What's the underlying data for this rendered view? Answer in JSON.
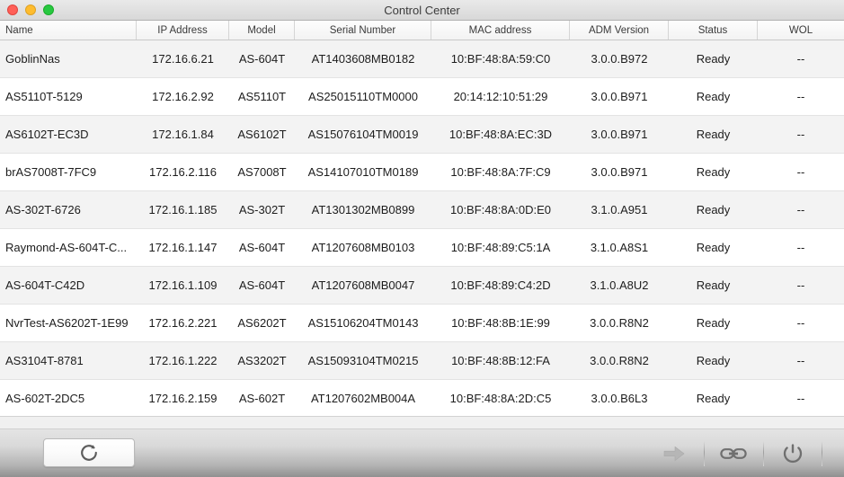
{
  "window": {
    "title": "Control Center",
    "traffic_lights": {
      "close": "close-button",
      "minimize": "minimize-button",
      "maximize": "maximize-button"
    },
    "colors": {
      "close": "#ff5f57",
      "minimize": "#febc2e",
      "maximize": "#28c840",
      "row_alt": "#f3f3f3",
      "row_base": "#ffffff",
      "toolbar_top": "#e4e4e4",
      "toolbar_bottom": "#909090"
    }
  },
  "table": {
    "columns": [
      "Name",
      "IP Address",
      "Model",
      "Serial Number",
      "MAC address",
      "ADM Version",
      "Status",
      "WOL"
    ],
    "rows": [
      {
        "name": "GoblinNas",
        "ip": "172.16.6.21",
        "model": "AS-604T",
        "serial": "AT1403608MB0182",
        "mac": "10:BF:48:8A:59:C0",
        "adm": "3.0.0.B972",
        "status": "Ready",
        "wol": "--"
      },
      {
        "name": "AS5110T-5129",
        "ip": "172.16.2.92",
        "model": "AS5110T",
        "serial": "AS25015110TM0000",
        "mac": "20:14:12:10:51:29",
        "adm": "3.0.0.B971",
        "status": "Ready",
        "wol": "--"
      },
      {
        "name": "AS6102T-EC3D",
        "ip": "172.16.1.84",
        "model": "AS6102T",
        "serial": "AS15076104TM0019",
        "mac": "10:BF:48:8A:EC:3D",
        "adm": "3.0.0.B971",
        "status": "Ready",
        "wol": "--"
      },
      {
        "name": "brAS7008T-7FC9",
        "ip": "172.16.2.116",
        "model": "AS7008T",
        "serial": "AS14107010TM0189",
        "mac": "10:BF:48:8A:7F:C9",
        "adm": "3.0.0.B971",
        "status": "Ready",
        "wol": "--"
      },
      {
        "name": "AS-302T-6726",
        "ip": "172.16.1.185",
        "model": "AS-302T",
        "serial": "AT1301302MB0899",
        "mac": "10:BF:48:8A:0D:E0",
        "adm": "3.1.0.A951",
        "status": "Ready",
        "wol": "--"
      },
      {
        "name": "Raymond-AS-604T-C...",
        "ip": "172.16.1.147",
        "model": "AS-604T",
        "serial": "AT1207608MB0103",
        "mac": "10:BF:48:89:C5:1A",
        "adm": "3.1.0.A8S1",
        "status": "Ready",
        "wol": "--"
      },
      {
        "name": "AS-604T-C42D",
        "ip": "172.16.1.109",
        "model": "AS-604T",
        "serial": "AT1207608MB0047",
        "mac": "10:BF:48:89:C4:2D",
        "adm": "3.1.0.A8U2",
        "status": "Ready",
        "wol": "--"
      },
      {
        "name": "NvrTest-AS6202T-1E99",
        "ip": "172.16.2.221",
        "model": "AS6202T",
        "serial": "AS15106204TM0143",
        "mac": "10:BF:48:8B:1E:99",
        "adm": "3.0.0.R8N2",
        "status": "Ready",
        "wol": "--"
      },
      {
        "name": "AS3104T-8781",
        "ip": "172.16.1.222",
        "model": "AS3202T",
        "serial": "AS15093104TM0215",
        "mac": "10:BF:48:8B:12:FA",
        "adm": "3.0.0.R8N2",
        "status": "Ready",
        "wol": "--"
      },
      {
        "name": "AS-602T-2DC5",
        "ip": "172.16.2.159",
        "model": "AS-602T",
        "serial": "AT1207602MB004A",
        "mac": "10:BF:48:8A:2D:C5",
        "adm": "3.0.0.B6L3",
        "status": "Ready",
        "wol": "--"
      }
    ]
  },
  "toolbar": {
    "refresh_icon": "refresh-icon",
    "actions": [
      {
        "icon": "arrow-right-icon",
        "name": "connect-action",
        "disabled": true
      },
      {
        "icon": "link-icon",
        "name": "link-action",
        "disabled": false
      },
      {
        "icon": "power-icon",
        "name": "power-action",
        "disabled": false
      }
    ]
  }
}
